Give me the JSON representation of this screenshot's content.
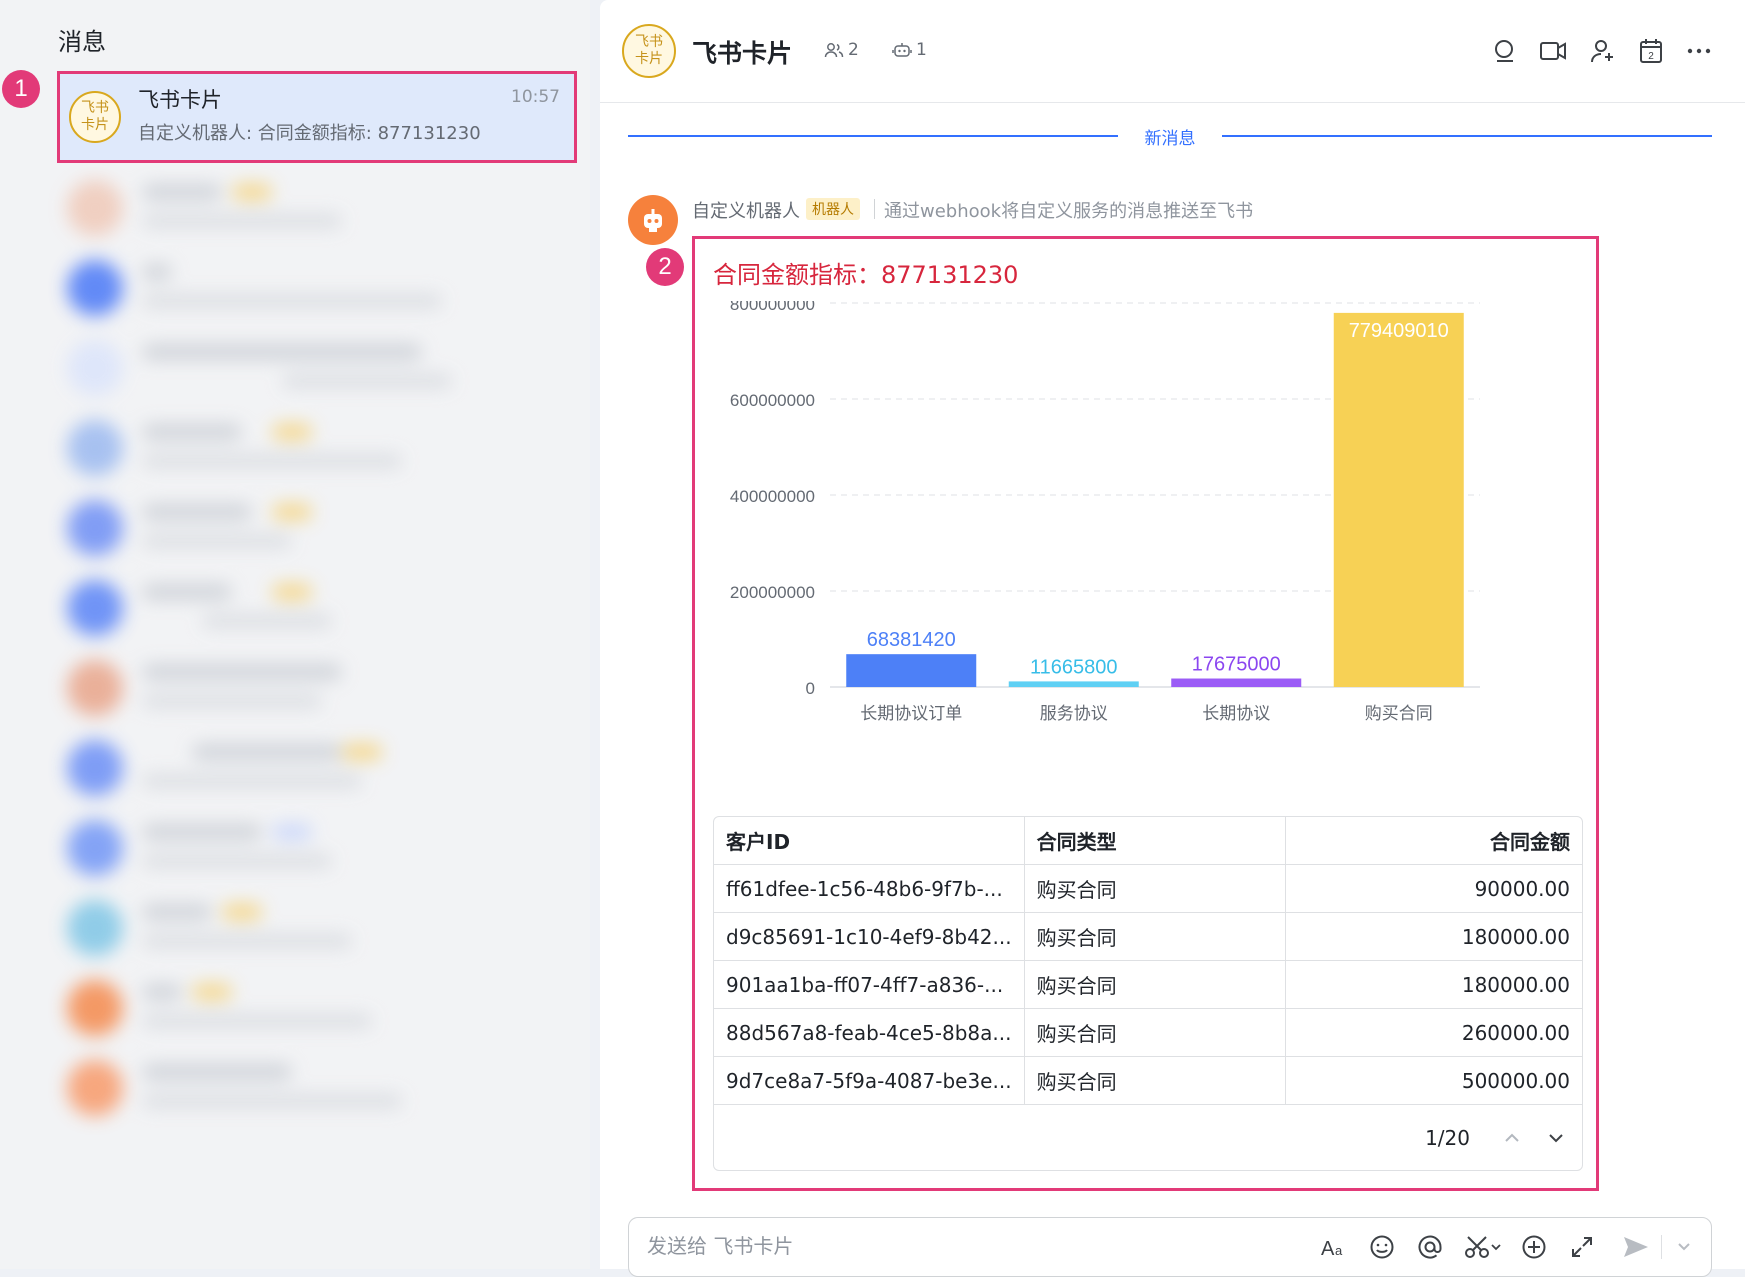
{
  "sidebar": {
    "title": "消息",
    "selected_chat": {
      "name": "飞书卡片",
      "avatar_text": "飞书卡片",
      "time": "10:57",
      "preview": "自定义机器人: 合同金额指标: 877131230"
    },
    "markers": [
      "1",
      "2"
    ]
  },
  "header": {
    "avatar_text": "飞书卡片",
    "title": "飞书卡片",
    "members_count": "2",
    "bots_count": "1",
    "icons": [
      "search-icon",
      "video-icon",
      "add-member-icon",
      "calendar-icon",
      "more-icon"
    ],
    "calendar_day": "2"
  },
  "divider_label": "新消息",
  "message": {
    "sender": "自定义机器人",
    "tag": "机器人",
    "description": "通过webhook将自定义服务的消息推送至飞书",
    "card_title": "合同金额指标：877131230"
  },
  "chart_data": {
    "type": "bar",
    "categories": [
      "长期协议订单",
      "服务协议",
      "长期协议",
      "购买合同"
    ],
    "values": [
      68381420,
      11665800,
      17675000,
      779409010
    ],
    "value_labels": [
      "68381420",
      "11665800",
      "17675000",
      "779409010"
    ],
    "colors": [
      "#4d80f7",
      "#5fd0f4",
      "#9b5cf6",
      "#f7d155"
    ],
    "label_colors": [
      "#4d80f7",
      "#37bde8",
      "#8b46f0",
      "#ffffff"
    ],
    "y_ticks": [
      0,
      200000000,
      400000000,
      600000000,
      800000000
    ],
    "y_tick_labels": [
      "0",
      "200000000",
      "400000000",
      "600000000",
      "800000000"
    ],
    "ylim": [
      0,
      800000000
    ],
    "grid": true
  },
  "table": {
    "headers": [
      "客户ID",
      "合同类型",
      "合同金额"
    ],
    "rows": [
      [
        "ff61dfee-1c56-48b6-9f7b-...",
        "购买合同",
        "90000.00"
      ],
      [
        "d9c85691-1c10-4ef9-8b42...",
        "购买合同",
        "180000.00"
      ],
      [
        "901aa1ba-ff07-4ff7-a836-...",
        "购买合同",
        "180000.00"
      ],
      [
        "88d567a8-feab-4ce5-8b8a...",
        "购买合同",
        "260000.00"
      ],
      [
        "9d7ce8a7-5f9a-4087-be3e...",
        "购买合同",
        "500000.00"
      ]
    ],
    "pagination": "1/20"
  },
  "input": {
    "placeholder": "发送给 飞书卡片",
    "tools": [
      "font-icon",
      "emoji-icon",
      "mention-icon",
      "scissors-icon",
      "add-icon",
      "expand-icon",
      "send-icon",
      "chevron-down-icon"
    ]
  }
}
